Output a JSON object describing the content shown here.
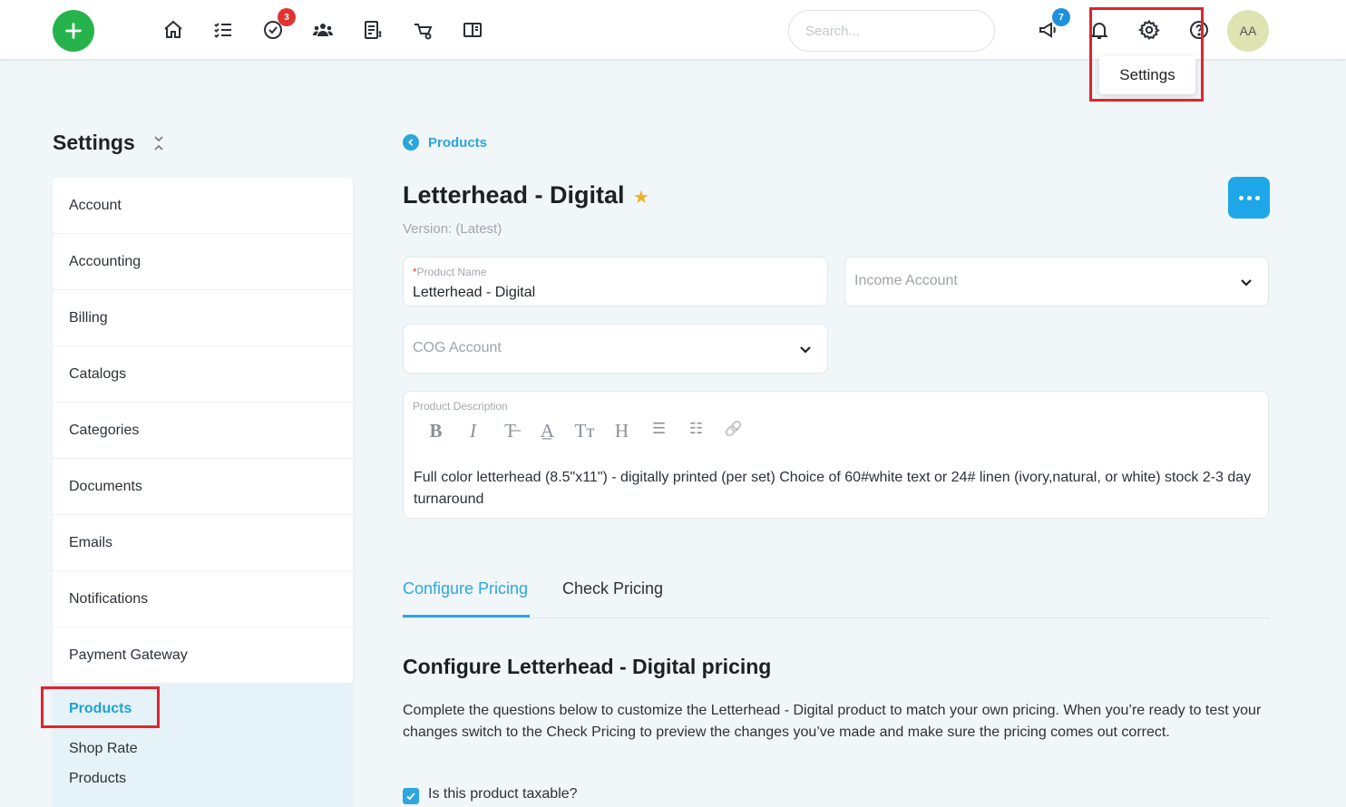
{
  "topbar": {
    "nav_icons": [
      "home-icon",
      "tasks-list-icon",
      "check-circle-icon",
      "team-icon",
      "invoice-icon",
      "catalog-icon",
      "book-icon"
    ],
    "tasks_badge": "3",
    "announcements_badge": "7",
    "search_placeholder": "Search...",
    "avatar_initials": "AA",
    "tooltip": "Settings"
  },
  "sidebar": {
    "title": "Settings",
    "items": [
      {
        "label": "Account"
      },
      {
        "label": "Accounting"
      },
      {
        "label": "Billing"
      },
      {
        "label": "Catalogs"
      },
      {
        "label": "Categories"
      },
      {
        "label": "Documents"
      },
      {
        "label": "Emails"
      },
      {
        "label": "Notifications"
      },
      {
        "label": "Payment Gateway"
      }
    ],
    "active_item": "Products",
    "sub_items": [
      "Shop Rate",
      "Products"
    ]
  },
  "main": {
    "breadcrumb": "Products",
    "title": "Letterhead - Digital",
    "version": "Version: (Latest)",
    "product_name_label": "Product Name",
    "product_name_value": "Letterhead - Digital",
    "income_account_placeholder": "Income Account",
    "cog_account_placeholder": "COG Account",
    "description_label": "Product Description",
    "rte_tools": [
      "B",
      "I",
      "T̶",
      "A̲",
      "Tт",
      "H",
      "☰",
      "☷",
      "🔗"
    ],
    "description_text": "Full color letterhead (8.5\"x11\") - digitally printed (per set) Choice of 60#white text or 24# linen (ivory,natural, or white) stock 2-3 day turnaround",
    "tabs": [
      {
        "label": "Configure Pricing",
        "active": true
      },
      {
        "label": "Check Pricing",
        "active": false
      }
    ],
    "section_title": "Configure Letterhead - Digital pricing",
    "section_desc": "Complete the questions below to customize the Letterhead - Digital product to match your own pricing. When you’re ready to test your changes switch to the Check Pricing to preview the changes you’ve made and make sure the pricing comes out correct.",
    "taxable_label": "Is this product taxable?",
    "taxable_checked": true
  },
  "colors": {
    "accent": "#2ea7df",
    "add_button": "#27b34b",
    "highlight": "#e0242d",
    "star": "#f0b326"
  }
}
